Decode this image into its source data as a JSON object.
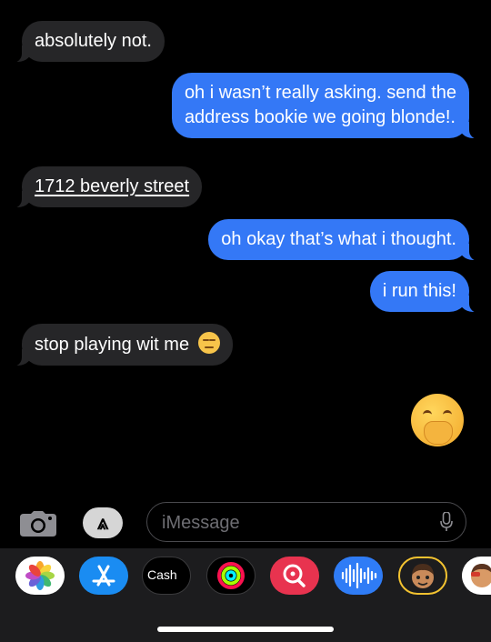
{
  "messages": [
    {
      "side": "in",
      "text": "absolutely not."
    },
    {
      "side": "out",
      "line1": "oh i wasn’t really asking. send the",
      "line2": "address bookie we going blonde!."
    },
    {
      "side": "in",
      "text": "1712 beverly street"
    },
    {
      "side": "out",
      "text": "oh okay that’s what i thought."
    },
    {
      "side": "out",
      "text": "i run this!"
    },
    {
      "side": "in",
      "text": "stop playing wit me"
    }
  ],
  "input": {
    "placeholder": "iMessage"
  },
  "apps": {
    "cash_label": "Cash"
  },
  "colors": {
    "outgoing": "#3478f6",
    "incoming": "#262628",
    "background": "#000000",
    "drawer": "#1c1c1e"
  },
  "icons": [
    "camera-icon",
    "app-store-icon",
    "microphone-icon",
    "photos-icon",
    "app-store-icon",
    "apple-cash-icon",
    "fitness-icon",
    "image-search-icon",
    "audio-icon",
    "memoji-icon",
    "memoji-sticker-icon"
  ]
}
